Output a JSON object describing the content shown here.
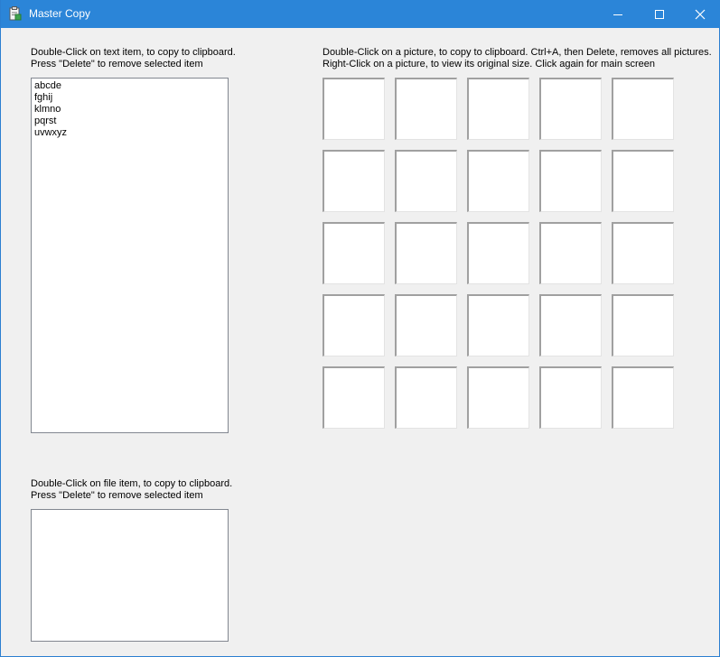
{
  "window": {
    "title": "Master Copy",
    "icon": "clipboard-app-icon",
    "titlebar_color": "#2b85d8"
  },
  "text_section": {
    "instruction_line1": "Double-Click on text item, to copy to clipboard.",
    "instruction_line2": "Press \"Delete\" to remove selected item",
    "items": [
      "abcde",
      "fghij",
      "klmno",
      "pqrst",
      "uvwxyz"
    ]
  },
  "picture_section": {
    "instruction_line1": "Double-Click on a picture, to copy to clipboard.  Ctrl+A, then Delete, removes all pictures.",
    "instruction_line2": "Right-Click on a picture, to view its original size. Click again for main screen",
    "rows": 5,
    "columns": 5
  },
  "file_section": {
    "instruction_line1": "Double-Click on file item, to copy to clipboard.",
    "instruction_line2": "Press \"Delete\" to remove selected item",
    "items": []
  }
}
